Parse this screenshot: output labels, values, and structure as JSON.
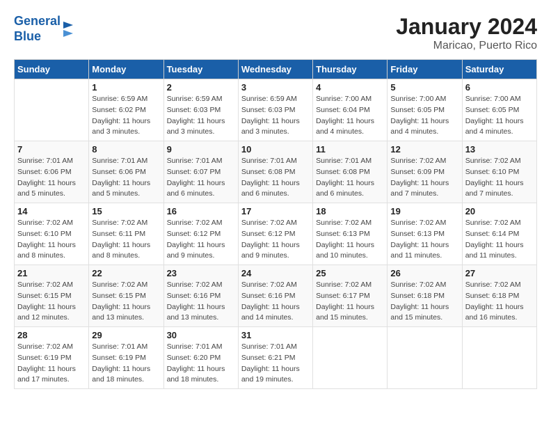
{
  "header": {
    "logo_line1": "General",
    "logo_line2": "Blue",
    "title": "January 2024",
    "subtitle": "Maricao, Puerto Rico"
  },
  "days_of_week": [
    "Sunday",
    "Monday",
    "Tuesday",
    "Wednesday",
    "Thursday",
    "Friday",
    "Saturday"
  ],
  "weeks": [
    [
      {
        "day": "",
        "info": ""
      },
      {
        "day": "1",
        "info": "Sunrise: 6:59 AM\nSunset: 6:02 PM\nDaylight: 11 hours\nand 3 minutes."
      },
      {
        "day": "2",
        "info": "Sunrise: 6:59 AM\nSunset: 6:03 PM\nDaylight: 11 hours\nand 3 minutes."
      },
      {
        "day": "3",
        "info": "Sunrise: 6:59 AM\nSunset: 6:03 PM\nDaylight: 11 hours\nand 3 minutes."
      },
      {
        "day": "4",
        "info": "Sunrise: 7:00 AM\nSunset: 6:04 PM\nDaylight: 11 hours\nand 4 minutes."
      },
      {
        "day": "5",
        "info": "Sunrise: 7:00 AM\nSunset: 6:05 PM\nDaylight: 11 hours\nand 4 minutes."
      },
      {
        "day": "6",
        "info": "Sunrise: 7:00 AM\nSunset: 6:05 PM\nDaylight: 11 hours\nand 4 minutes."
      }
    ],
    [
      {
        "day": "7",
        "info": "Sunrise: 7:01 AM\nSunset: 6:06 PM\nDaylight: 11 hours\nand 5 minutes."
      },
      {
        "day": "8",
        "info": "Sunrise: 7:01 AM\nSunset: 6:06 PM\nDaylight: 11 hours\nand 5 minutes."
      },
      {
        "day": "9",
        "info": "Sunrise: 7:01 AM\nSunset: 6:07 PM\nDaylight: 11 hours\nand 6 minutes."
      },
      {
        "day": "10",
        "info": "Sunrise: 7:01 AM\nSunset: 6:08 PM\nDaylight: 11 hours\nand 6 minutes."
      },
      {
        "day": "11",
        "info": "Sunrise: 7:01 AM\nSunset: 6:08 PM\nDaylight: 11 hours\nand 6 minutes."
      },
      {
        "day": "12",
        "info": "Sunrise: 7:02 AM\nSunset: 6:09 PM\nDaylight: 11 hours\nand 7 minutes."
      },
      {
        "day": "13",
        "info": "Sunrise: 7:02 AM\nSunset: 6:10 PM\nDaylight: 11 hours\nand 7 minutes."
      }
    ],
    [
      {
        "day": "14",
        "info": "Sunrise: 7:02 AM\nSunset: 6:10 PM\nDaylight: 11 hours\nand 8 minutes."
      },
      {
        "day": "15",
        "info": "Sunrise: 7:02 AM\nSunset: 6:11 PM\nDaylight: 11 hours\nand 8 minutes."
      },
      {
        "day": "16",
        "info": "Sunrise: 7:02 AM\nSunset: 6:12 PM\nDaylight: 11 hours\nand 9 minutes."
      },
      {
        "day": "17",
        "info": "Sunrise: 7:02 AM\nSunset: 6:12 PM\nDaylight: 11 hours\nand 9 minutes."
      },
      {
        "day": "18",
        "info": "Sunrise: 7:02 AM\nSunset: 6:13 PM\nDaylight: 11 hours\nand 10 minutes."
      },
      {
        "day": "19",
        "info": "Sunrise: 7:02 AM\nSunset: 6:13 PM\nDaylight: 11 hours\nand 11 minutes."
      },
      {
        "day": "20",
        "info": "Sunrise: 7:02 AM\nSunset: 6:14 PM\nDaylight: 11 hours\nand 11 minutes."
      }
    ],
    [
      {
        "day": "21",
        "info": "Sunrise: 7:02 AM\nSunset: 6:15 PM\nDaylight: 11 hours\nand 12 minutes."
      },
      {
        "day": "22",
        "info": "Sunrise: 7:02 AM\nSunset: 6:15 PM\nDaylight: 11 hours\nand 13 minutes."
      },
      {
        "day": "23",
        "info": "Sunrise: 7:02 AM\nSunset: 6:16 PM\nDaylight: 11 hours\nand 13 minutes."
      },
      {
        "day": "24",
        "info": "Sunrise: 7:02 AM\nSunset: 6:16 PM\nDaylight: 11 hours\nand 14 minutes."
      },
      {
        "day": "25",
        "info": "Sunrise: 7:02 AM\nSunset: 6:17 PM\nDaylight: 11 hours\nand 15 minutes."
      },
      {
        "day": "26",
        "info": "Sunrise: 7:02 AM\nSunset: 6:18 PM\nDaylight: 11 hours\nand 15 minutes."
      },
      {
        "day": "27",
        "info": "Sunrise: 7:02 AM\nSunset: 6:18 PM\nDaylight: 11 hours\nand 16 minutes."
      }
    ],
    [
      {
        "day": "28",
        "info": "Sunrise: 7:02 AM\nSunset: 6:19 PM\nDaylight: 11 hours\nand 17 minutes."
      },
      {
        "day": "29",
        "info": "Sunrise: 7:01 AM\nSunset: 6:19 PM\nDaylight: 11 hours\nand 18 minutes."
      },
      {
        "day": "30",
        "info": "Sunrise: 7:01 AM\nSunset: 6:20 PM\nDaylight: 11 hours\nand 18 minutes."
      },
      {
        "day": "31",
        "info": "Sunrise: 7:01 AM\nSunset: 6:21 PM\nDaylight: 11 hours\nand 19 minutes."
      },
      {
        "day": "",
        "info": ""
      },
      {
        "day": "",
        "info": ""
      },
      {
        "day": "",
        "info": ""
      }
    ]
  ]
}
